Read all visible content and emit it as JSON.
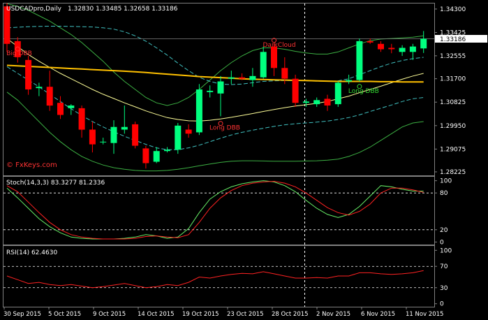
{
  "header": {
    "symbol": "USDCADpro,Daily",
    "ohlc": "1.32830 1.33485 1.32658 1.33186"
  },
  "watermark": "© FxKeys.com",
  "current_price": "1.33186",
  "colors": {
    "background": "#000000",
    "border": "#808080",
    "bull_candle": "#00ff7f",
    "bear_candle": "#ff0000",
    "ma_slow": "#ffc000",
    "ma_fast": "#ffff99",
    "bb_outer": "#3cb043",
    "bb_mid": "#40c0c0",
    "stoch_main": "#66ee66",
    "stoch_signal": "#ff2222",
    "rsi_line": "#ff2222",
    "pattern_red": "#ff3333",
    "pattern_green": "#33dd33",
    "watermark": "#ff3333"
  },
  "chart_data": [
    {
      "type": "candlestick",
      "panel": "price",
      "y_ticks": [
        "1.34300",
        "1.33425",
        "1.32555",
        "1.31700",
        "1.30825",
        "1.29950",
        "1.29075",
        "1.28225"
      ],
      "ylim": [
        1.2812,
        1.3448
      ],
      "x_ticks": [
        "30 Sep 2015",
        "5 Oct 2015",
        "9 Oct 2015",
        "14 Oct 2015",
        "19 Oct 2015",
        "23 Oct 2015",
        "28 Oct 2015",
        "2 Nov 2015",
        "6 Nov 2015",
        "11 Nov 2015"
      ],
      "candles": [
        {
          "o": 1.344,
          "h": 1.3452,
          "l": 1.327,
          "c": 1.33
        },
        {
          "o": 1.331,
          "h": 1.3325,
          "l": 1.323,
          "c": 1.325
        },
        {
          "o": 1.324,
          "h": 1.3255,
          "l": 1.311,
          "c": 1.313
        },
        {
          "o": 1.3135,
          "h": 1.3155,
          "l": 1.3105,
          "c": 1.314
        },
        {
          "o": 1.314,
          "h": 1.32,
          "l": 1.305,
          "c": 1.307
        },
        {
          "o": 1.308,
          "h": 1.3105,
          "l": 1.302,
          "c": 1.3035
        },
        {
          "o": 1.306,
          "h": 1.3075,
          "l": 1.3035,
          "c": 1.307
        },
        {
          "o": 1.306,
          "h": 1.307,
          "l": 1.295,
          "c": 1.298
        },
        {
          "o": 1.298,
          "h": 1.301,
          "l": 1.2895,
          "c": 1.2925
        },
        {
          "o": 1.2935,
          "h": 1.295,
          "l": 1.2925,
          "c": 1.2935
        },
        {
          "o": 1.293,
          "h": 1.3015,
          "l": 1.289,
          "c": 1.299
        },
        {
          "o": 1.298,
          "h": 1.307,
          "l": 1.2965,
          "c": 1.299
        },
        {
          "o": 1.3,
          "h": 1.301,
          "l": 1.291,
          "c": 1.292
        },
        {
          "o": 1.291,
          "h": 1.292,
          "l": 1.2835,
          "c": 1.2855
        },
        {
          "o": 1.286,
          "h": 1.2915,
          "l": 1.2855,
          "c": 1.29
        },
        {
          "o": 1.29,
          "h": 1.2915,
          "l": 1.2895,
          "c": 1.2905
        },
        {
          "o": 1.2905,
          "h": 1.3005,
          "l": 1.289,
          "c": 1.2995
        },
        {
          "o": 1.298,
          "h": 1.3,
          "l": 1.295,
          "c": 1.2965
        },
        {
          "o": 1.297,
          "h": 1.315,
          "l": 1.296,
          "c": 1.313
        },
        {
          "o": 1.312,
          "h": 1.3145,
          "l": 1.31,
          "c": 1.3125
        },
        {
          "o": 1.3115,
          "h": 1.318,
          "l": 1.303,
          "c": 1.316
        },
        {
          "o": 1.317,
          "h": 1.32,
          "l": 1.315,
          "c": 1.3175
        },
        {
          "o": 1.3175,
          "h": 1.319,
          "l": 1.3165,
          "c": 1.317
        },
        {
          "o": 1.3165,
          "h": 1.321,
          "l": 1.314,
          "c": 1.318
        },
        {
          "o": 1.3175,
          "h": 1.329,
          "l": 1.317,
          "c": 1.327
        },
        {
          "o": 1.329,
          "h": 1.33,
          "l": 1.318,
          "c": 1.321
        },
        {
          "o": 1.321,
          "h": 1.325,
          "l": 1.315,
          "c": 1.317
        },
        {
          "o": 1.317,
          "h": 1.3185,
          "l": 1.3065,
          "c": 1.308
        },
        {
          "o": 1.308,
          "h": 1.3095,
          "l": 1.3065,
          "c": 1.3085
        },
        {
          "o": 1.3075,
          "h": 1.31,
          "l": 1.3065,
          "c": 1.309
        },
        {
          "o": 1.3095,
          "h": 1.311,
          "l": 1.305,
          "c": 1.307
        },
        {
          "o": 1.3075,
          "h": 1.316,
          "l": 1.3065,
          "c": 1.3155
        },
        {
          "o": 1.316,
          "h": 1.3185,
          "l": 1.315,
          "c": 1.3165
        },
        {
          "o": 1.3165,
          "h": 1.332,
          "l": 1.316,
          "c": 1.331
        },
        {
          "o": 1.331,
          "h": 1.332,
          "l": 1.33,
          "c": 1.3305
        },
        {
          "o": 1.33,
          "h": 1.331,
          "l": 1.327,
          "c": 1.328
        },
        {
          "o": 1.3285,
          "h": 1.33,
          "l": 1.3265,
          "c": 1.328
        },
        {
          "o": 1.327,
          "h": 1.3295,
          "l": 1.3255,
          "c": 1.3285
        },
        {
          "o": 1.327,
          "h": 1.33,
          "l": 1.324,
          "c": 1.329
        },
        {
          "o": 1.3283,
          "h": 1.3348,
          "l": 1.3266,
          "c": 1.3319
        }
      ],
      "ma_slow": [
        1.322,
        1.3218,
        1.3216,
        1.3214,
        1.3212,
        1.321,
        1.3208,
        1.3206,
        1.3204,
        1.3202,
        1.32,
        1.3198,
        1.3196,
        1.3193,
        1.319,
        1.3187,
        1.3184,
        1.3181,
        1.3178,
        1.3176,
        1.3174,
        1.3172,
        1.317,
        1.3168,
        1.3167,
        1.3166,
        1.3165,
        1.3164,
        1.3163,
        1.3162,
        1.3161,
        1.316,
        1.316,
        1.316,
        1.316,
        1.3159,
        1.3159,
        1.3158,
        1.3158,
        1.3158
      ],
      "ma_fast": [
        1.332,
        1.329,
        1.326,
        1.3235,
        1.3212,
        1.319,
        1.317,
        1.315,
        1.313,
        1.3112,
        1.3096,
        1.308,
        1.3065,
        1.305,
        1.3037,
        1.3025,
        1.3018,
        1.3013,
        1.3012,
        1.3015,
        1.302,
        1.3026,
        1.3033,
        1.304,
        1.3048,
        1.3055,
        1.3062,
        1.3068,
        1.3073,
        1.3078,
        1.3085,
        1.3095,
        1.3105,
        1.3118,
        1.313,
        1.3142,
        1.3155,
        1.3168,
        1.318,
        1.319
      ],
      "bb_upper": [
        1.345,
        1.344,
        1.3425,
        1.3405,
        1.3385,
        1.336,
        1.3335,
        1.3305,
        1.327,
        1.3235,
        1.3195,
        1.316,
        1.313,
        1.31,
        1.308,
        1.307,
        1.308,
        1.31,
        1.313,
        1.3165,
        1.32,
        1.323,
        1.3255,
        1.3275,
        1.3285,
        1.3285,
        1.328,
        1.3272,
        1.3266,
        1.3262,
        1.3262,
        1.327,
        1.3285,
        1.33,
        1.3312,
        1.3318,
        1.332,
        1.3322,
        1.3325,
        1.333
      ],
      "bb_mid_upper": [
        1.336,
        1.3362,
        1.3364,
        1.3365,
        1.3366,
        1.3366,
        1.3365,
        1.3364,
        1.3363,
        1.336,
        1.3355,
        1.3345,
        1.333,
        1.331,
        1.3285,
        1.3258,
        1.3228,
        1.32,
        1.3175,
        1.316,
        1.315,
        1.3148,
        1.315,
        1.3155,
        1.316,
        1.3162,
        1.3163,
        1.3163,
        1.3162,
        1.3161,
        1.316,
        1.3162,
        1.317,
        1.3185,
        1.32,
        1.3215,
        1.3228,
        1.3238,
        1.3245,
        1.325
      ],
      "bb_mid_lower": [
        1.3215,
        1.319,
        1.3165,
        1.314,
        1.3112,
        1.3085,
        1.3058,
        1.3033,
        1.301,
        1.299,
        1.2972,
        1.2955,
        1.294,
        1.2925,
        1.2912,
        1.2905,
        1.2905,
        1.2912,
        1.2922,
        1.2935,
        1.2948,
        1.296,
        1.297,
        1.2978,
        1.2985,
        1.2992,
        1.2998,
        1.3002,
        1.3005,
        1.3008,
        1.3012,
        1.3018,
        1.3025,
        1.3035,
        1.3048,
        1.306,
        1.3072,
        1.3085,
        1.3095,
        1.31
      ],
      "bb_lower": [
        1.312,
        1.309,
        1.305,
        1.301,
        1.297,
        1.2935,
        1.2905,
        1.288,
        1.2862,
        1.2848,
        1.2838,
        1.2832,
        1.2828,
        1.2826,
        1.2826,
        1.2828,
        1.2832,
        1.2838,
        1.2845,
        1.2852,
        1.2858,
        1.2862,
        1.2864,
        1.2864,
        1.2863,
        1.2862,
        1.2862,
        1.2862,
        1.2863,
        1.2864,
        1.2866,
        1.287,
        1.288,
        1.2895,
        1.2915,
        1.294,
        1.2965,
        1.299,
        1.3005,
        1.301
      ],
      "annotations": [
        {
          "label": "Big DBB",
          "index": 1,
          "price": 1.3268,
          "color": "red"
        },
        {
          "label": "DarkCloud",
          "index": 25,
          "price": 1.33,
          "color": "red"
        },
        {
          "label": "Long DBB",
          "index": 20,
          "price": 1.299,
          "color": "red"
        },
        {
          "label": "Long DBB",
          "index": 33,
          "price": 1.3128,
          "color": "green"
        }
      ]
    },
    {
      "type": "line",
      "panel": "stochastic",
      "title": "Stoch(14,3,3) 83.3277 81.2336",
      "y_ticks": [
        "100",
        "80",
        "20",
        "0"
      ],
      "ylim": [
        -3,
        103
      ],
      "levels": [
        80,
        20
      ],
      "series": [
        {
          "name": "main",
          "values": [
            88,
            72,
            55,
            38,
            25,
            15,
            8,
            6,
            5,
            5,
            5,
            6,
            8,
            12,
            10,
            6,
            8,
            22,
            48,
            70,
            82,
            90,
            95,
            98,
            100,
            98,
            92,
            82,
            68,
            55,
            45,
            40,
            45,
            58,
            75,
            92,
            90,
            86,
            83,
            83
          ]
        },
        {
          "name": "signal",
          "values": [
            92,
            82,
            65,
            48,
            32,
            20,
            12,
            8,
            6,
            5,
            5,
            5,
            6,
            9,
            10,
            8,
            7,
            12,
            32,
            55,
            72,
            84,
            92,
            96,
            98,
            99,
            96,
            90,
            80,
            68,
            56,
            48,
            44,
            50,
            62,
            80,
            88,
            88,
            85,
            81
          ]
        }
      ]
    },
    {
      "type": "line",
      "panel": "rsi",
      "title": "RSI(14) 62.4630",
      "y_ticks": [
        "100",
        "70",
        "30",
        "0"
      ],
      "ylim": [
        -3,
        103
      ],
      "levels": [
        70,
        30
      ],
      "series": [
        {
          "name": "rsi",
          "values": [
            52,
            45,
            38,
            40,
            36,
            34,
            36,
            33,
            30,
            32,
            35,
            38,
            34,
            30,
            32,
            36,
            34,
            40,
            50,
            48,
            52,
            55,
            57,
            56,
            60,
            56,
            52,
            48,
            48,
            49,
            48,
            52,
            52,
            58,
            58,
            56,
            55,
            56,
            58,
            62
          ]
        }
      ]
    }
  ]
}
